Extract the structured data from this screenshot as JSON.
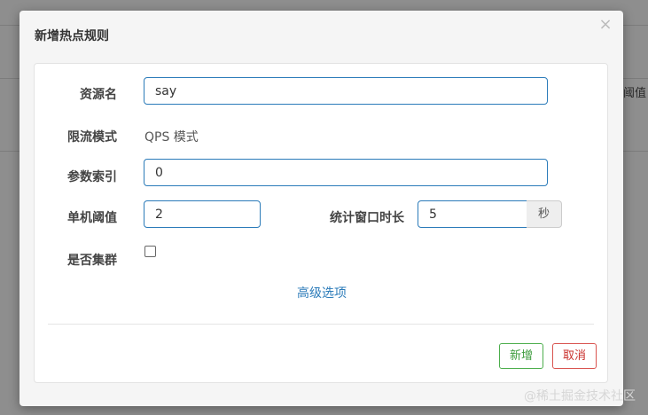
{
  "background": {
    "partial_column_text": "阈值"
  },
  "modal": {
    "title": "新增热点规则",
    "close_glyph": "×"
  },
  "form": {
    "resource_name": {
      "label": "资源名",
      "value": "say"
    },
    "flow_mode": {
      "label": "限流模式",
      "value": "QPS 模式"
    },
    "param_index": {
      "label": "参数索引",
      "value": "0"
    },
    "threshold": {
      "label": "单机阈值",
      "value": "2"
    },
    "window": {
      "label": "统计窗口时长",
      "value": "5",
      "unit": "秒"
    },
    "cluster": {
      "label": "是否集群",
      "checked": false
    }
  },
  "advanced_link": "高级选项",
  "buttons": {
    "add": "新增",
    "cancel": "取消"
  },
  "watermark": "@稀土掘金技术社区",
  "colors": {
    "accent": "#2b7bb9",
    "success": "#4cae4c",
    "danger": "#d9534f"
  }
}
